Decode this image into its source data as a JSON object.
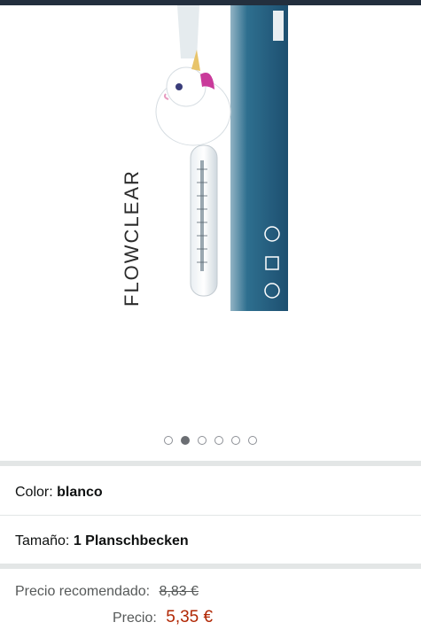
{
  "gallery": {
    "image_brand_text": "FLOWCLEAR",
    "dots_count": 6,
    "active_dot_index": 1
  },
  "variations": {
    "color_label": "Color:",
    "color_value": "blanco",
    "size_label": "Tamaño:",
    "size_value": "1 Planschbecken"
  },
  "pricing": {
    "rrp_label": "Precio recomendado:",
    "rrp_value": "8,83 €",
    "price_label": "Precio:",
    "price_value": "5,35 €",
    "price_color": "#b12704"
  }
}
